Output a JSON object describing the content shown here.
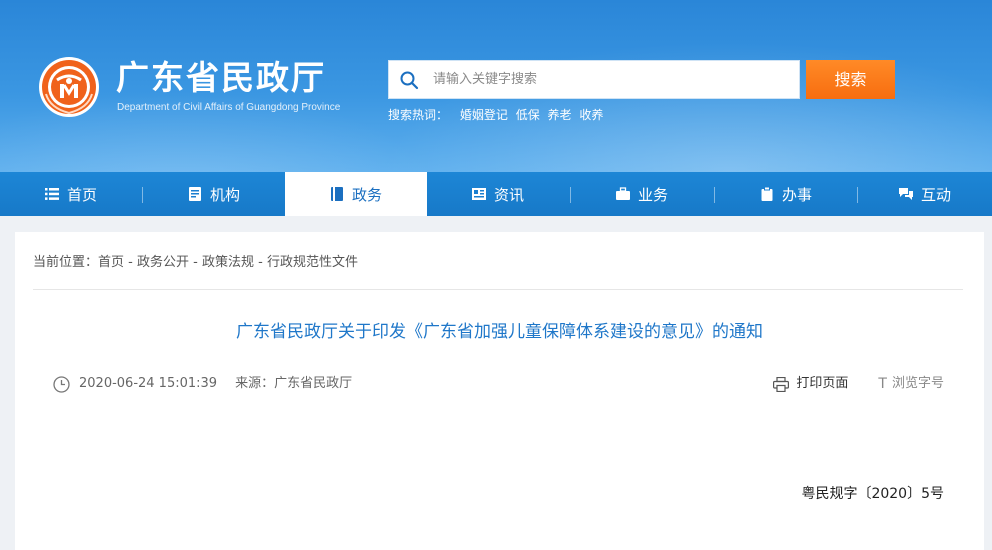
{
  "header": {
    "site_title": "广东省民政厅",
    "site_subtitle": "Department of Civil Affairs of Guangdong Province",
    "search": {
      "placeholder": "请输入关键字搜索",
      "value": "",
      "button_label": "搜索"
    },
    "hotwords": {
      "label": "搜索热词：",
      "items": [
        "婚姻登记",
        "低保",
        "养老",
        "收养"
      ]
    }
  },
  "nav": {
    "items": [
      {
        "label": "首页",
        "icon": "list-icon"
      },
      {
        "label": "机构",
        "icon": "building-doc-icon"
      },
      {
        "label": "政务",
        "icon": "book-icon",
        "active": true
      },
      {
        "label": "资讯",
        "icon": "news-icon"
      },
      {
        "label": "业务",
        "icon": "briefcase-icon"
      },
      {
        "label": "办事",
        "icon": "clipboard-icon"
      },
      {
        "label": "互动",
        "icon": "chat-bubbles-icon"
      }
    ]
  },
  "article": {
    "breadcrumb": {
      "prefix": "当前位置：",
      "items": [
        "首页",
        "政务公开",
        "政策法规",
        "行政规范性文件"
      ],
      "separator": " - "
    },
    "title": "广东省民政厅关于印发《广东省加强儿童保障体系建设的意见》的通知",
    "datetime": "2020-06-24 15:01:39",
    "source": "来源：广东省民政厅",
    "print_label": "打印页面",
    "font_label": "浏览字号",
    "doc_number": "粤民规字〔2020〕5号"
  },
  "colors": {
    "header_blue": "#2a86d8",
    "nav_blue": "#1b7fd0",
    "accent_orange": "#f7780f",
    "title_blue": "#1f77c9"
  }
}
